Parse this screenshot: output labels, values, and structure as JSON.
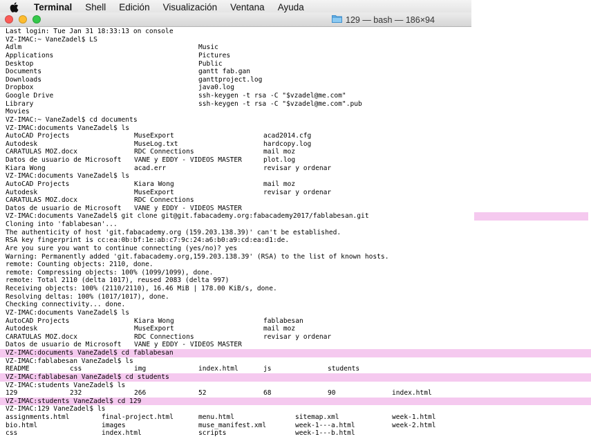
{
  "menubar": {
    "items": [
      "Terminal",
      "Shell",
      "Edición",
      "Visualización",
      "Ventana",
      "Ayuda"
    ]
  },
  "window": {
    "title": "129 — bash — 186×94"
  },
  "terminal": {
    "lines": [
      {
        "cols": [
          "Last login: Tue Jan 31 18:33:13 on console"
        ]
      },
      {
        "cols": [
          "VZ-IMAC:~ VaneZadel$ LS"
        ]
      },
      {
        "cols": [
          "Adlm",
          "Music"
        ],
        "x": [
          8,
          287
        ]
      },
      {
        "cols": [
          "Applications",
          "Pictures"
        ],
        "x": [
          8,
          287
        ]
      },
      {
        "cols": [
          "Desktop",
          "Public"
        ],
        "x": [
          8,
          287
        ]
      },
      {
        "cols": [
          "Documents",
          "gantt fab.gan"
        ],
        "x": [
          8,
          287
        ]
      },
      {
        "cols": [
          "Downloads",
          "ganttproject.log"
        ],
        "x": [
          8,
          287
        ]
      },
      {
        "cols": [
          "Dropbox",
          "java0.log"
        ],
        "x": [
          8,
          287
        ]
      },
      {
        "cols": [
          "Google Drive",
          "ssh-keygen -t rsa -C \"$vzadel@me.com\""
        ],
        "x": [
          8,
          287
        ]
      },
      {
        "cols": [
          "Library",
          "ssh-keygen -t rsa -C \"$vzadel@me.com\".pub"
        ],
        "x": [
          8,
          287
        ]
      },
      {
        "cols": [
          "Movies"
        ]
      },
      {
        "cols": [
          "VZ-IMAC:~ VaneZadel$ cd documents"
        ]
      },
      {
        "cols": [
          "VZ-IMAC:documents VaneZadel$ ls"
        ]
      },
      {
        "cols": [
          "AutoCAD Projects",
          "MuseExport",
          "acad2014.cfg"
        ],
        "x": [
          8,
          194,
          381
        ]
      },
      {
        "cols": [
          "Autodesk",
          "MuseLog.txt",
          "hardcopy.log"
        ],
        "x": [
          8,
          194,
          381
        ]
      },
      {
        "cols": [
          "CARATULAS MOZ.docx",
          "RDC Connections",
          "mail moz"
        ],
        "x": [
          8,
          194,
          381
        ]
      },
      {
        "cols": [
          "Datos de usuario de Microsoft",
          "VANE y EDDY - VIDEOS MASTER",
          "plot.log"
        ],
        "x": [
          8,
          194,
          381
        ]
      },
      {
        "cols": [
          "Kiara Wong",
          "acad.err",
          "revisar y ordenar"
        ],
        "x": [
          8,
          194,
          381
        ]
      },
      {
        "cols": [
          "VZ-IMAC:documents VaneZadel$ ls"
        ]
      },
      {
        "cols": [
          "AutoCAD Projects",
          "Kiara Wong",
          "mail moz"
        ],
        "x": [
          8,
          194,
          381
        ]
      },
      {
        "cols": [
          "Autodesk",
          "MuseExport",
          "revisar y ordenar"
        ],
        "x": [
          8,
          194,
          381
        ]
      },
      {
        "cols": [
          "CARATULAS MOZ.docx",
          "RDC Connections"
        ],
        "x": [
          8,
          194
        ]
      },
      {
        "cols": [
          "Datos de usuario de Microsoft",
          "VANE y EDDY - VIDEOS MASTER"
        ],
        "x": [
          8,
          194
        ]
      },
      {
        "cols": [
          "VZ-IMAC:documents VaneZadel$ git clone git@git.fabacademy.org:fabacademy2017/fablabesan.git"
        ],
        "hlRight": true
      },
      {
        "cols": [
          "Cloning into 'fablabesan'..."
        ]
      },
      {
        "cols": [
          "The authenticity of host 'git.fabacademy.org (159.203.138.39)' can't be established."
        ]
      },
      {
        "cols": [
          "RSA key fingerprint is cc:ea:0b:bf:1e:ab:c7:9c:24:a6:b0:a9:cd:ea:d1:de."
        ]
      },
      {
        "cols": [
          "Are you sure you want to continue connecting (yes/no)? yes"
        ]
      },
      {
        "cols": [
          "Warning: Permanently added 'git.fabacademy.org,159.203.138.39' (RSA) to the list of known hosts."
        ]
      },
      {
        "cols": [
          "remote: Counting objects: 2110, done."
        ]
      },
      {
        "cols": [
          "remote: Compressing objects: 100% (1099/1099), done."
        ]
      },
      {
        "cols": [
          "remote: Total 2110 (delta 1017), reused 2083 (delta 997)"
        ]
      },
      {
        "cols": [
          "Receiving objects: 100% (2110/2110), 16.46 MiB | 178.00 KiB/s, done."
        ]
      },
      {
        "cols": [
          "Resolving deltas: 100% (1017/1017), done."
        ]
      },
      {
        "cols": [
          "Checking connectivity... done."
        ]
      },
      {
        "cols": [
          "VZ-IMAC:documents VaneZadel$ ls"
        ]
      },
      {
        "cols": [
          "AutoCAD Projects",
          "Kiara Wong",
          "fablabesan"
        ],
        "x": [
          8,
          194,
          381
        ]
      },
      {
        "cols": [
          "Autodesk",
          "MuseExport",
          "mail moz"
        ],
        "x": [
          8,
          194,
          381
        ]
      },
      {
        "cols": [
          "CARATULAS MOZ.docx",
          "RDC Connections",
          "revisar y ordenar"
        ],
        "x": [
          8,
          194,
          381
        ]
      },
      {
        "cols": [
          "Datos de usuario de Microsoft",
          "VANE y EDDY - VIDEOS MASTER"
        ],
        "x": [
          8,
          194
        ]
      },
      {
        "cols": [
          "VZ-IMAC:documents VaneZadel$ cd fablabesan"
        ],
        "hl": true
      },
      {
        "cols": [
          "VZ-IMAC:fablabesan VaneZadel$ ls"
        ]
      },
      {
        "cols": [
          "README",
          "css",
          "img",
          "index.html",
          "js",
          "students"
        ],
        "x": [
          8,
          101,
          194,
          287,
          381,
          474
        ]
      },
      {
        "cols": [
          "VZ-IMAC:fablabesan VaneZadel$ cd students"
        ],
        "hl": true
      },
      {
        "cols": [
          "VZ-IMAC:students VaneZadel$ ls"
        ]
      },
      {
        "cols": [
          "129",
          "232",
          "266",
          "52",
          "68",
          "90",
          "index.html"
        ],
        "x": [
          8,
          101,
          194,
          287,
          381,
          474,
          567
        ]
      },
      {
        "cols": [
          "VZ-IMAC:students VaneZadel$ cd 129"
        ],
        "hl": true
      },
      {
        "cols": [
          "VZ-IMAC:129 VaneZadel$ ls"
        ]
      },
      {
        "cols": [
          "assignments.html",
          "final-project.html",
          "menu.html",
          "sitemap.xml",
          "week-1.html"
        ],
        "x": [
          8,
          147,
          287,
          427,
          567
        ]
      },
      {
        "cols": [
          "bio.html",
          "images",
          "muse_manifest.xml",
          "week-1---a.html",
          "week-2.html"
        ],
        "x": [
          8,
          147,
          287,
          427,
          567
        ]
      },
      {
        "cols": [
          "css",
          "index.html",
          "scripts",
          "week-1---b.html"
        ],
        "x": [
          8,
          147,
          287,
          427
        ]
      }
    ]
  }
}
